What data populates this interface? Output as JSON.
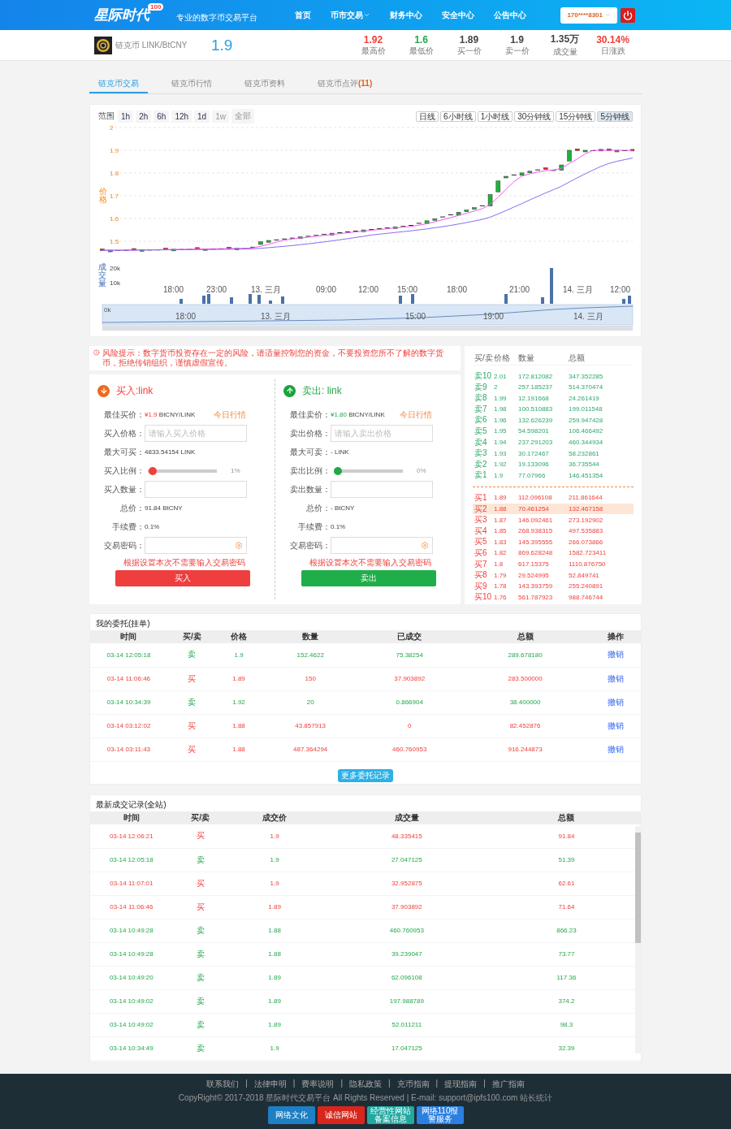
{
  "header": {
    "logo": "星际时代",
    "logo_badge": "100",
    "slogan": "专业的数字币交易平台",
    "nav": [
      {
        "label": "首页",
        "has_menu": false
      },
      {
        "label": "币市交易",
        "has_menu": true
      },
      {
        "label": "财务中心",
        "has_menu": false
      },
      {
        "label": "安全中心",
        "has_menu": false
      },
      {
        "label": "公告中心",
        "has_menu": false
      }
    ],
    "user": "170****8301"
  },
  "ticker": {
    "coin": "链克币 LINK/BtCNY",
    "price": "1.9",
    "stats": [
      {
        "value": "1.92",
        "label": "最高价",
        "color": "#f0403c"
      },
      {
        "value": "1.6",
        "label": "最低价",
        "color": "#22a84a"
      },
      {
        "value": "1.89",
        "label": "买一价",
        "color": "#444444"
      },
      {
        "value": "1.9",
        "label": "卖一价",
        "color": "#444444"
      },
      {
        "value": "1.35万",
        "label": "成交量",
        "color": "#444444"
      },
      {
        "value": "30.14%",
        "label": "日涨跌",
        "color": "#f0403c"
      }
    ]
  },
  "tabs": [
    {
      "label": "链克币交易",
      "selected": true
    },
    {
      "label": "链克币行情",
      "selected": false
    },
    {
      "label": "链克币资料",
      "selected": false
    },
    {
      "label": "链克币点评",
      "count": "(11)",
      "selected": false
    }
  ],
  "chart": {
    "range_label": "范围",
    "ranges": [
      {
        "label": "1h",
        "disabled": false
      },
      {
        "label": "2h",
        "disabled": false
      },
      {
        "label": "6h",
        "disabled": false
      },
      {
        "label": "12h",
        "disabled": false
      },
      {
        "label": "1d",
        "disabled": false
      },
      {
        "label": "1w",
        "disabled": true
      },
      {
        "label": "全部",
        "disabled": true
      }
    ],
    "periods": [
      {
        "label": "日线",
        "selected": false
      },
      {
        "label": "6小时线",
        "selected": false
      },
      {
        "label": "1小时线",
        "selected": false
      },
      {
        "label": "30分钟线",
        "selected": false
      },
      {
        "label": "15分钟线",
        "selected": false
      },
      {
        "label": "5分钟线",
        "selected": true
      }
    ],
    "price_axis_title": "价格",
    "volume_axis_title": "成交量",
    "yticks": [
      "2",
      "1.9",
      "1.8",
      "1.7",
      "1.6",
      "1.5"
    ],
    "volume_ticks": [
      "20k",
      "10k"
    ],
    "xlabels": [
      "18:00",
      "23:00",
      "13. 三月",
      "09:00",
      "12:00",
      "15:00",
      "18:00",
      "21:00",
      "14. 三月",
      "12:00"
    ],
    "navigator_zero": "0k",
    "navigator_labels": [
      "18:00",
      "13. 三月",
      "15:00",
      "19:00",
      "14. 三月"
    ]
  },
  "notice": "风险提示：数字货币投资存在一定的风险，请适量控制您的资金，不要投资您所不了解的数字货币，拒绝传销组织，谨慎虚假宣传。",
  "forms": [
    {
      "kind": "buy",
      "title": "买入:link",
      "best_label": "最佳买价：",
      "best_price": "¥1.9",
      "best_unit": "BtCNY/LINK",
      "market_link": "今日行情",
      "price_label": "买入价格：",
      "price_placeholder": "请输入买入价格",
      "max_label": "最大可买：",
      "max_value": "4833.54154 LINK",
      "ratio_label": "买入比例：",
      "level": 0.01,
      "ratio_value": "1%",
      "qty_label": "买入数量：",
      "total_label": "总价：",
      "total_value": "91.84 BtCNY",
      "fee_label": "手续费：",
      "fee_value": "0.1%",
      "password_label": "交易密码：",
      "hint": "根据设置本次不需要输入交易密码",
      "button": "买入"
    },
    {
      "kind": "sell",
      "title": "卖出: link",
      "best_label": "最佳卖价：",
      "best_price": "¥1.80",
      "best_unit": "BtCNY/LINK",
      "market_link": "今日行情",
      "price_label": "卖出价格：",
      "price_placeholder": "请输入卖出价格",
      "max_label": "最大可卖：",
      "max_value": "- LINK",
      "ratio_label": "卖出比例：",
      "level": 0,
      "ratio_value": "0%",
      "qty_label": "卖出数量：",
      "total_label": "总价：",
      "total_value": "- BtCNY",
      "fee_label": "手续费：",
      "fee_value": "0.1%",
      "password_label": "交易密码：",
      "hint": "根据设置本次不需要输入交易密码",
      "button": "卖出"
    }
  ],
  "order_book": {
    "columns": [
      "买/卖",
      "价格",
      "数量",
      "总额"
    ],
    "asks": [
      {
        "side": "卖10",
        "price": "2.01",
        "amount": "172.812082",
        "total": "347.352285",
        "selected": false
      },
      {
        "side": "卖9",
        "price": "2",
        "amount": "257.185237",
        "total": "514.370474",
        "selected": false
      },
      {
        "side": "卖8",
        "price": "1.99",
        "amount": "12.191668",
        "total": "24.261419",
        "selected": false
      },
      {
        "side": "卖7",
        "price": "1.98",
        "amount": "100.510883",
        "total": "199.011548",
        "selected": false
      },
      {
        "side": "卖6",
        "price": "1.96",
        "amount": "132.626239",
        "total": "259.947428",
        "selected": false
      },
      {
        "side": "卖5",
        "price": "1.95",
        "amount": "54.598201",
        "total": "106.466492",
        "selected": false
      },
      {
        "side": "卖4",
        "price": "1.94",
        "amount": "237.291203",
        "total": "460.344934",
        "selected": false
      },
      {
        "side": "卖3",
        "price": "1.93",
        "amount": "30.172467",
        "total": "58.232861",
        "selected": false
      },
      {
        "side": "卖2",
        "price": "1.92",
        "amount": "19.133096",
        "total": "36.735544",
        "selected": false
      },
      {
        "side": "卖1",
        "price": "1.9",
        "amount": "77.07966",
        "total": "146.451354",
        "selected": false
      }
    ],
    "bids": [
      {
        "side": "买1",
        "price": "1.89",
        "amount": "112.096108",
        "total": "211.861644",
        "selected": false
      },
      {
        "side": "买2",
        "price": "1.88",
        "amount": "70.461254",
        "total": "132.467158",
        "selected": true
      },
      {
        "side": "买3",
        "price": "1.87",
        "amount": "146.092461",
        "total": "273.192902",
        "selected": false
      },
      {
        "side": "买4",
        "price": "1.85",
        "amount": "268.938315",
        "total": "497.535883",
        "selected": false
      },
      {
        "side": "买5",
        "price": "1.83",
        "amount": "145.395555",
        "total": "266.073866",
        "selected": false
      },
      {
        "side": "买6",
        "price": "1.82",
        "amount": "869.628248",
        "total": "1582.723411",
        "selected": false
      },
      {
        "side": "买7",
        "price": "1.8",
        "amount": "617.15375",
        "total": "1110.876750",
        "selected": false
      },
      {
        "side": "买8",
        "price": "1.79",
        "amount": "29.524995",
        "total": "52.849741",
        "selected": false
      },
      {
        "side": "买9",
        "price": "1.78",
        "amount": "143.393759",
        "total": "255.240891",
        "selected": false
      },
      {
        "side": "买10",
        "price": "1.76",
        "amount": "561.787923",
        "total": "988.746744",
        "selected": false
      }
    ]
  },
  "my_orders": {
    "title": "我的委托(挂单)",
    "columns": [
      "时间",
      "买/卖",
      "价格",
      "数量",
      "已成交",
      "总额",
      "操作"
    ],
    "rows": [
      {
        "kind": "sell",
        "cells": [
          "03-14 12:05:18",
          "卖",
          "1.9",
          "152.4622",
          "75.38254",
          "289.678180"
        ],
        "action": "撤销"
      },
      {
        "kind": "buy",
        "cells": [
          "03-14 11:06:46",
          "买",
          "1.89",
          "150",
          "37.903892",
          "283.500000"
        ],
        "action": "撤销"
      },
      {
        "kind": "sell",
        "cells": [
          "03-14 10:34:39",
          "卖",
          "1.92",
          "20",
          "0.866904",
          "38.400000"
        ],
        "action": "撤销"
      },
      {
        "kind": "buy",
        "cells": [
          "03-14 03:12:02",
          "买",
          "1.88",
          "43.857913",
          "0",
          "82.452876"
        ],
        "action": "撤销"
      },
      {
        "kind": "buy",
        "cells": [
          "03-14 03:11:43",
          "买",
          "1.88",
          "487.364294",
          "460.760953",
          "916.244873"
        ],
        "action": "撤销"
      }
    ],
    "more_button": "更多委托记录"
  },
  "trades": {
    "title": "最新成交记录(全站)",
    "columns": [
      "时间",
      "买/卖",
      "成交价",
      "成交量",
      "总额"
    ],
    "rows": [
      {
        "kind": "buy",
        "cells": [
          "03-14 12:06:21",
          "买",
          "1.9",
          "48.335415",
          "91.84"
        ]
      },
      {
        "kind": "sell",
        "cells": [
          "03-14 12:05:18",
          "卖",
          "1.9",
          "27.047125",
          "51.39"
        ]
      },
      {
        "kind": "buy",
        "cells": [
          "03-14 11:07:01",
          "买",
          "1.9",
          "32.952875",
          "62.61"
        ]
      },
      {
        "kind": "buy",
        "cells": [
          "03-14 11:06:46",
          "买",
          "1.89",
          "37.903892",
          "71.64"
        ]
      },
      {
        "kind": "sell",
        "cells": [
          "03-14 10:49:28",
          "卖",
          "1.88",
          "460.760953",
          "866.23"
        ]
      },
      {
        "kind": "sell",
        "cells": [
          "03-14 10:49:28",
          "卖",
          "1.88",
          "39.239047",
          "73.77"
        ]
      },
      {
        "kind": "sell",
        "cells": [
          "03-14 10:49:20",
          "卖",
          "1.89",
          "62.096108",
          "117.36"
        ]
      },
      {
        "kind": "sell",
        "cells": [
          "03-14 10:49:02",
          "卖",
          "1.89",
          "197.988789",
          "374.2"
        ]
      },
      {
        "kind": "sell",
        "cells": [
          "03-14 10:49:02",
          "卖",
          "1.89",
          "52.011211",
          "98.3"
        ]
      },
      {
        "kind": "sell",
        "cells": [
          "03-14 10:34:49",
          "卖",
          "1.9",
          "17.047125",
          "32.39"
        ]
      }
    ]
  },
  "footer": {
    "separator": "|",
    "links": [
      "联系我们",
      "法律申明",
      "费率说明",
      "隐私政策",
      "充币指南",
      "提现指南",
      "推广指南"
    ],
    "copyright": "CopyRight© 2017-2018 星际时代交易平台 All Rights Reserved | E-mail: support@ipfs100.com 站长统计",
    "badges": [
      {
        "label": "网络文化",
        "color": "#1d7fc4"
      },
      {
        "label": "诚信网站",
        "color": "#d9261c"
      },
      {
        "label": "经营性网站备案信息",
        "color": "#22a8a0"
      },
      {
        "label": "网络110报警服务",
        "color": "#2b7fe0"
      }
    ]
  }
}
